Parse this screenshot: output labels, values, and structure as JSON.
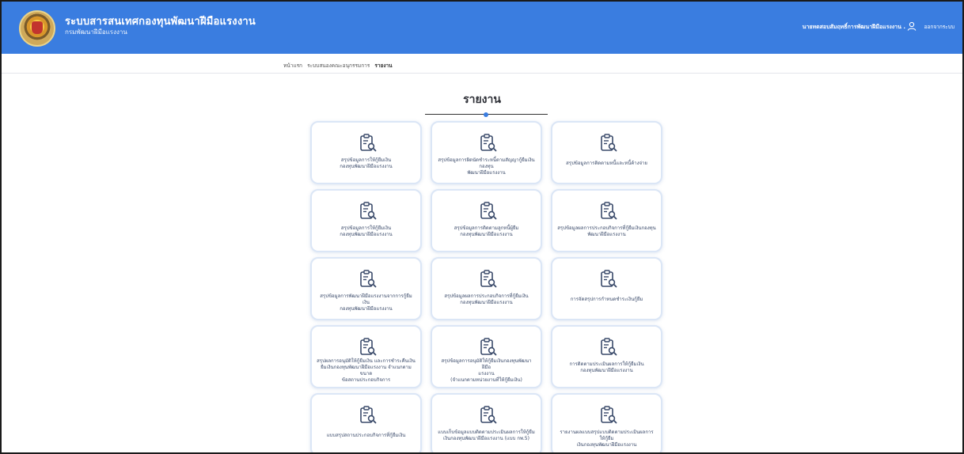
{
  "header": {
    "title": "ระบบสารสนเทศกองทุนพัฒนาฝีมือแรงงาน",
    "subtitle": "กรมพัฒนาฝีมือแรงงาน",
    "user_name": "นายทดสอบสัมฤทธิ์การพัฒนาฝีมือแรงงาน .",
    "logout": "ออกจากระบบ"
  },
  "breadcrumb": {
    "home": "หน้าแรก",
    "system": "ระบบสนองคณะอนุกรรมการ",
    "current": "รายงาน"
  },
  "page": {
    "title": "รายงาน"
  },
  "colors": {
    "header_bg": "#3a7de0",
    "accent": "#3a7de0",
    "card_border": "#dbe6f6"
  },
  "cards": [
    {
      "label": "สรุปข้อมูลการให้กู้ยืมเงิน\nกองทุนพัฒนาฝีมือแรงงาน",
      "icon": "report-clipboard-icon"
    },
    {
      "label": "สรุปข้อมูลการผิดนัดชำระหนี้ตามสัญญากู้ยืมเงินกองทุน\nพัฒนาฝีมือแรงงาน",
      "icon": "report-clipboard-icon"
    },
    {
      "label": "สรุปข้อมูลการติดตามหนี้และหนี้ค้างจ่าย",
      "icon": "report-clipboard-icon"
    },
    {
      "label": "สรุปข้อมูลการให้กู้ยืมเงิน\nกองทุนพัฒนาฝีมือแรงงาน",
      "icon": "report-clipboard-icon"
    },
    {
      "label": "สรุปข้อมูลการติดตามลูกหนี้ผู้ยืม\nกองทุนพัฒนาฝีมือแรงงาน",
      "icon": "report-clipboard-icon"
    },
    {
      "label": "สรุปข้อมูลผลการประกอบกิจการที่กู้ยืมเงินกองทุน\nพัฒนาฝีมือแรงงาน",
      "icon": "report-clipboard-icon"
    },
    {
      "label": "สรุปข้อมูลการพัฒนาฝีมือแรงงานจากการกู้ยืมเงิน\nกองทุนพัฒนาฝีมือแรงงาน",
      "icon": "report-clipboard-icon"
    },
    {
      "label": "สรุปข้อมูลผลการประกอบกิจการที่กู้ยืมเงิน\nกองทุนพัฒนาฝีมือแรงงาน",
      "icon": "report-clipboard-icon"
    },
    {
      "label": "การจัดสรุปการกำหนดชำระเงินกู้ยืม",
      "icon": "report-clipboard-icon"
    },
    {
      "label": "สรุปผลการอนุมัติให้กู้ยืมเงิน และการชำระคืนเงิน\nยืมเงินกองทุนพัฒนาฝีมือแรงงาน จำแนกตามขนาด\nข้อสถานประกอบกิจการ",
      "icon": "report-clipboard-icon"
    },
    {
      "label": "สรุปข้อมูลการอนุมัติให้กู้ยืมเงินกองทุนพัฒนาฝีมือ\nแรงงาน\n(จำแนกตามหน่วยงานที่ให้กู้ยืมเงิน)",
      "icon": "report-clipboard-icon"
    },
    {
      "label": "การติดตามประเมินผลการให้กู้ยืมเงิน\nกองทุนพัฒนาฝีมือแรงงาน",
      "icon": "report-clipboard-icon"
    },
    {
      "label": "แบบสรุปสถานประกอบกิจการที่กู้ยืมเงิน",
      "icon": "report-clipboard-icon"
    },
    {
      "label": "แบบเก็บข้อมูลแบบติดตามประเมินผลการให้กู้ยืม\nเงินกองทุนพัฒนาฝีมือแรงงาน (แบบ กพ.5)",
      "icon": "report-clipboard-icon"
    },
    {
      "label": "รายงานผลแบบสรุปแบบติดตามประเมินผลการให้กู้ยืม\nเงินกองทุนพัฒนาฝีมือแรงงาน",
      "icon": "report-clipboard-icon"
    }
  ]
}
